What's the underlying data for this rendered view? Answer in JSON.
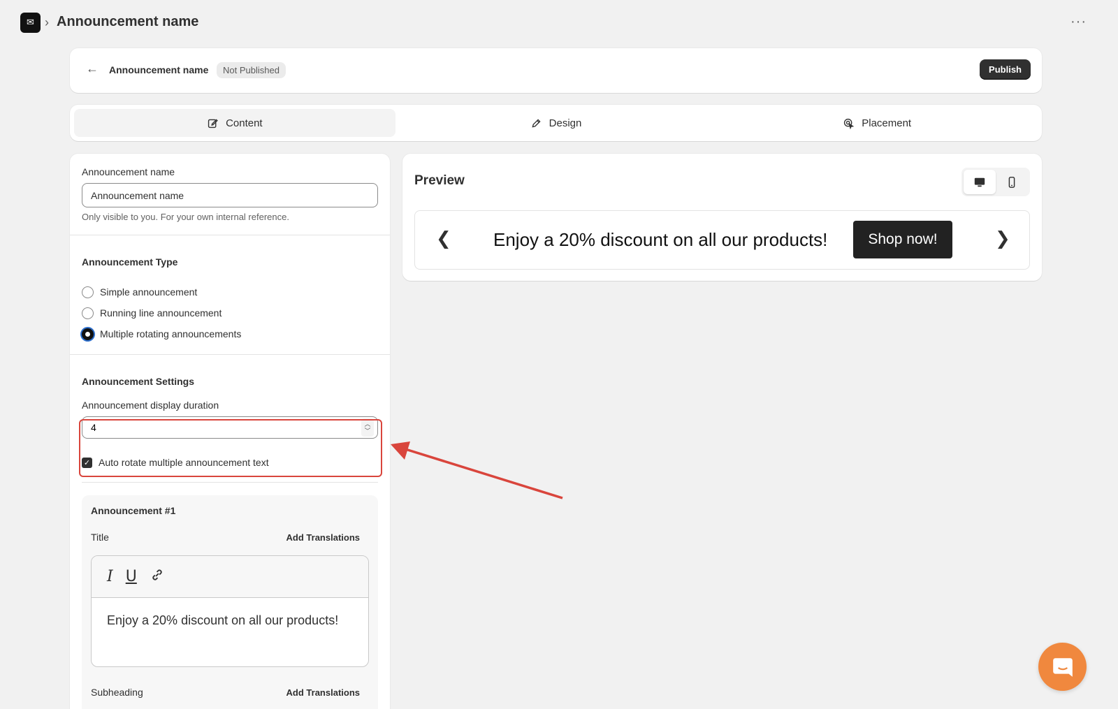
{
  "app": {
    "logo_text": "✉",
    "breadcrumb_title": "Announcement name",
    "more_label": "···"
  },
  "header": {
    "name": "Announcement name",
    "status": "Not Published",
    "publish_label": "Publish"
  },
  "tabs": [
    {
      "label": "Content",
      "icon": "edit-square-icon",
      "active": true
    },
    {
      "label": "Design",
      "icon": "pencil-icon",
      "active": false
    },
    {
      "label": "Placement",
      "icon": "target-pointer-icon",
      "active": false
    }
  ],
  "form": {
    "name_label": "Announcement name",
    "name_value": "Announcement name",
    "name_help": "Only visible to you. For your own internal reference.",
    "type_title": "Announcement Type",
    "types": [
      {
        "label": "Simple announcement",
        "checked": false
      },
      {
        "label": "Running line announcement",
        "checked": false
      },
      {
        "label": "Multiple rotating announcements",
        "checked": true
      }
    ],
    "settings_title": "Announcement Settings",
    "duration_label": "Announcement display duration",
    "duration_value": "4",
    "auto_rotate_label": "Auto rotate multiple announcement text",
    "auto_rotate_checked": true,
    "announcement": {
      "heading": "Announcement #1",
      "title_label": "Title",
      "add_translations": "Add Translations",
      "title_text": "Enjoy a 20% discount on all our products!",
      "subheading_label": "Subheading",
      "subheading_add_translations": "Add Translations"
    }
  },
  "preview": {
    "title": "Preview",
    "bar_text": "Enjoy a 20% discount on all our products!",
    "button_label": "Shop now!",
    "prev_arrow": "❮",
    "next_arrow": "❯"
  },
  "colors": {
    "highlight": "#d9453c",
    "chat": "#f0883e",
    "primary": "#303030"
  }
}
